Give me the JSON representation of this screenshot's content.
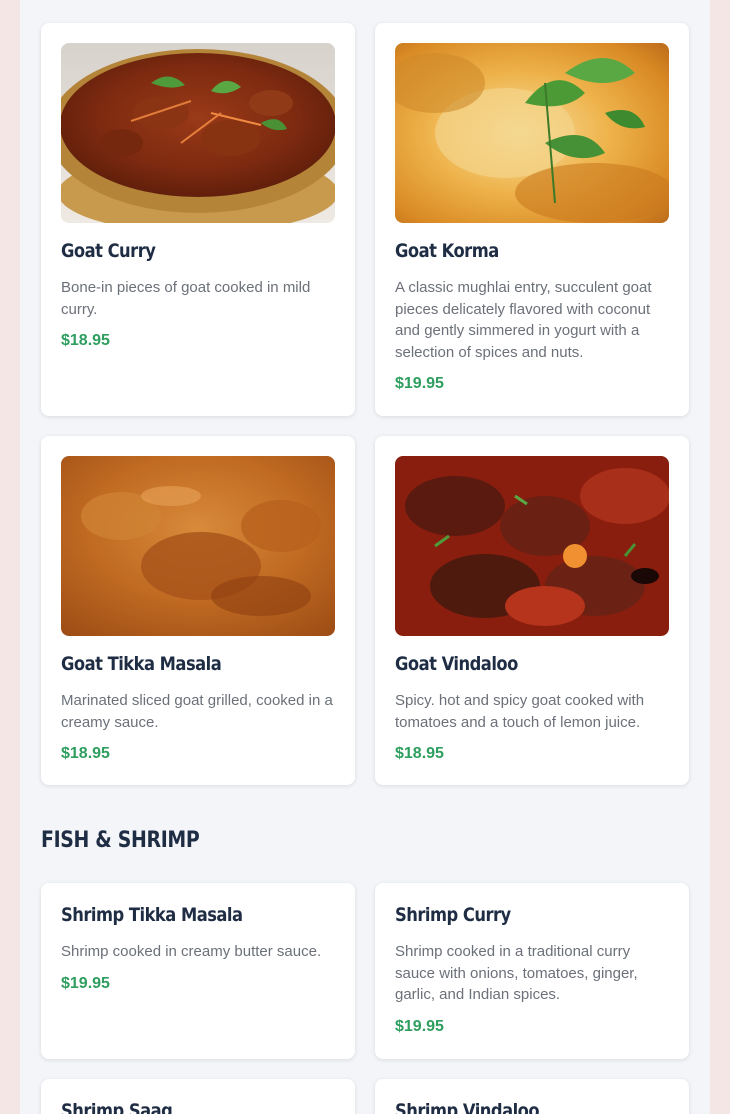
{
  "menu": {
    "goat_items": [
      {
        "name": "Goat Curry",
        "description": "Bone-in pieces of goat cooked in mild curry.",
        "price": "$18.95",
        "image_icon": "goat-curry-photo"
      },
      {
        "name": "Goat Korma",
        "description": "A classic mughlai entry, succulent goat pieces delicately flavored with coconut and gently simmered in yogurt with a selection of spices and nuts.",
        "price": "$19.95",
        "image_icon": "goat-korma-photo"
      },
      {
        "name": "Goat Tikka Masala",
        "description": "Marinated sliced goat grilled, cooked in a creamy sauce.",
        "price": "$18.95",
        "image_icon": "goat-tikka-masala-photo"
      },
      {
        "name": "Goat Vindaloo",
        "description": "Spicy. hot and spicy goat cooked with tomatoes and a touch of lemon juice.",
        "price": "$18.95",
        "image_icon": "goat-vindaloo-photo"
      }
    ],
    "fish_section": {
      "title": "FISH & SHRIMP",
      "items": [
        {
          "name": "Shrimp Tikka Masala",
          "description": "Shrimp cooked in creamy butter sauce.",
          "price": "$19.95"
        },
        {
          "name": "Shrimp Curry",
          "description": "Shrimp cooked in a traditional curry sauce with onions, tomatoes, ginger, garlic, and Indian spices.",
          "price": "$19.95"
        },
        {
          "name": "Shrimp Saag"
        },
        {
          "name": "Shrimp Vindaloo"
        }
      ]
    }
  },
  "colors": {
    "page_bg": "#f3f5f8",
    "outer_bg": "#f5e6e6",
    "title": "#1f2d44",
    "description": "#6b7079",
    "price": "#2e9e5f"
  }
}
